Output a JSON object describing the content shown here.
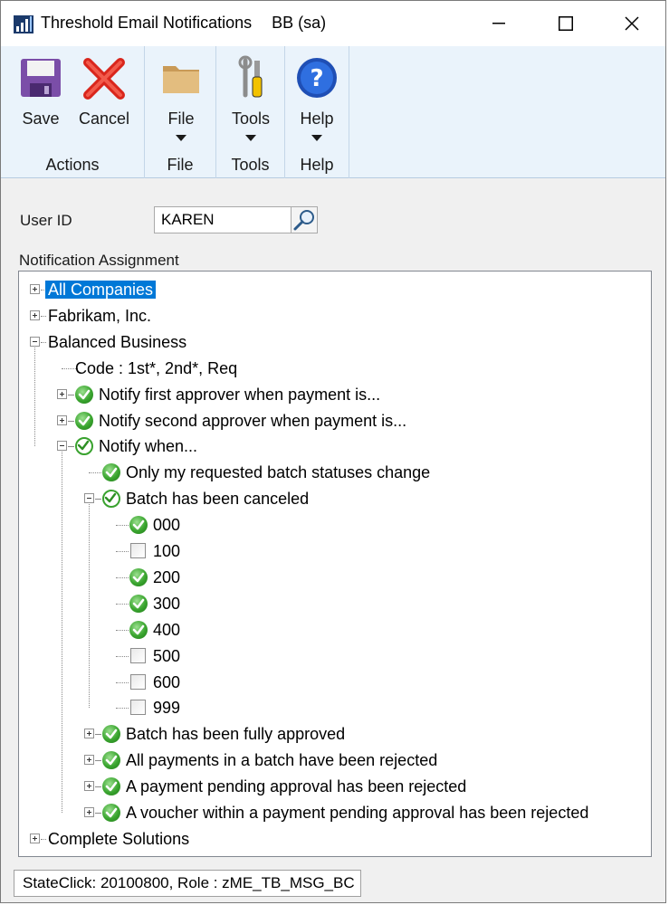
{
  "window": {
    "title": "Threshold Email Notifications",
    "subtitle": "BB (sa)"
  },
  "ribbon": {
    "groups": [
      {
        "label": "Actions",
        "buttons": [
          {
            "label": "Save",
            "icon": "save-icon"
          },
          {
            "label": "Cancel",
            "icon": "cancel-icon"
          }
        ]
      },
      {
        "label": "File",
        "buttons": [
          {
            "label": "File",
            "icon": "folder-icon"
          }
        ]
      },
      {
        "label": "Tools",
        "buttons": [
          {
            "label": "Tools",
            "icon": "tools-icon"
          }
        ]
      },
      {
        "label": "Help",
        "buttons": [
          {
            "label": "Help",
            "icon": "help-icon"
          }
        ]
      }
    ]
  },
  "form": {
    "user_id_label": "User ID",
    "user_id_value": "KAREN",
    "assignment_label": "Notification Assignment"
  },
  "tree": {
    "nodes": [
      {
        "text": "All Companies",
        "level": 0,
        "expander": "plus",
        "check": "none",
        "selected": true
      },
      {
        "text": "Fabrikam, Inc.",
        "level": 0,
        "expander": "plus",
        "check": "none"
      },
      {
        "text": "Balanced Business",
        "level": 0,
        "expander": "minus",
        "check": "none"
      },
      {
        "text": "Code : 1st*, 2nd*, Req",
        "level": 1,
        "expander": "none",
        "check": "none"
      },
      {
        "text": "Notify first approver when payment is...",
        "level": 1,
        "expander": "plus",
        "check": "checked"
      },
      {
        "text": "Notify second approver when payment is...",
        "level": 1,
        "expander": "plus",
        "check": "checked"
      },
      {
        "text": "Notify when...",
        "level": 1,
        "expander": "minus",
        "check": "partial"
      },
      {
        "text": "Only my requested batch statuses change",
        "level": 2,
        "expander": "none",
        "check": "checked"
      },
      {
        "text": "Batch has been canceled",
        "level": 2,
        "expander": "minus",
        "check": "partial"
      },
      {
        "text": "000",
        "level": 3,
        "expander": "none",
        "check": "checked"
      },
      {
        "text": "100",
        "level": 3,
        "expander": "none",
        "check": "unchecked"
      },
      {
        "text": "200",
        "level": 3,
        "expander": "none",
        "check": "checked"
      },
      {
        "text": "300",
        "level": 3,
        "expander": "none",
        "check": "checked"
      },
      {
        "text": "400",
        "level": 3,
        "expander": "none",
        "check": "checked"
      },
      {
        "text": "500",
        "level": 3,
        "expander": "none",
        "check": "unchecked"
      },
      {
        "text": "600",
        "level": 3,
        "expander": "none",
        "check": "unchecked"
      },
      {
        "text": "999",
        "level": 3,
        "expander": "none",
        "check": "unchecked"
      },
      {
        "text": "Batch has been fully approved",
        "level": 2,
        "expander": "plus",
        "check": "checked"
      },
      {
        "text": "All payments in a batch have been rejected",
        "level": 2,
        "expander": "plus",
        "check": "checked"
      },
      {
        "text": "A payment pending approval has been rejected",
        "level": 2,
        "expander": "plus",
        "check": "checked"
      },
      {
        "text": "A voucher within a payment pending approval has been rejected",
        "level": 2,
        "expander": "plus",
        "check": "checked"
      },
      {
        "text": "Complete Solutions",
        "level": 0,
        "expander": "plus",
        "check": "none"
      }
    ]
  },
  "status": {
    "text": "StateClick: 20100800, Role : zME_TB_MSG_BC"
  },
  "colors": {
    "selection": "#0078d7",
    "ribbon_bg": "#eaf3fb",
    "check_green": "#3aa52f"
  }
}
